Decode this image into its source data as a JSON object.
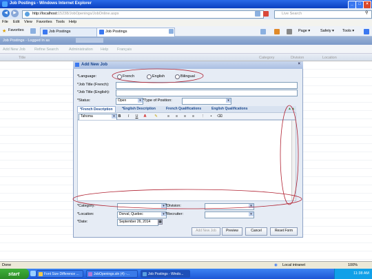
{
  "window": {
    "title": "Job Postings - Windows Internet Explorer"
  },
  "browser": {
    "address_host": "http://localhost:",
    "address_rest": "15238/JobOpenings/JobOnline.aspx",
    "search_placeholder": "Live Search",
    "menu": [
      "File",
      "Edit",
      "View",
      "Favorites",
      "Tools",
      "Help"
    ],
    "favorites_label": "Favorites",
    "tabs": [
      "Job Postings",
      "Job Postings"
    ],
    "commands": [
      "Page ▾",
      "Safety ▾",
      "Tools ▾"
    ]
  },
  "page": {
    "header": "Job Postings - Logged In as",
    "toolbar": [
      "Add New Job",
      "Refine Search",
      "Administration",
      "Help",
      "Français"
    ],
    "columns": [
      "Title",
      "Category",
      "Division",
      "Location"
    ]
  },
  "dialog": {
    "title": "Add New Job",
    "language_label": "*Language:",
    "language_options": [
      "French",
      "English",
      "Bilingual"
    ],
    "job_title_fr_label": "*Job Title (French):",
    "job_title_en_label": "*Job Title (English):",
    "status_label": "*Status:",
    "status_value": "Open",
    "position_type_label": "*Type of Position:",
    "editor_tabs": [
      "*French Description",
      "*English Description",
      "French Qualifications",
      "English Qualifications"
    ],
    "font_value": "Tahoma",
    "toolbar_glyphs": [
      "B",
      "I",
      "U",
      "A"
    ],
    "category_label": "*Category:",
    "division_label": "*Division:",
    "location_label": "*Location:",
    "location_value": "Dorval, Quebec",
    "recruiter_label": "*Recruiter:",
    "date_label": "*Date:",
    "date_value": "September 26, 2014",
    "buttons": [
      "Add New Job",
      "Preview",
      "Cancel",
      "Reset Form"
    ]
  },
  "statusbar": {
    "left": "Done",
    "zone": "Local intranet",
    "zoom": "100%"
  },
  "taskbar": {
    "start": "start",
    "tasks": [
      "Font Size Difference ...",
      "JobOpenings.sln (4) -...",
      "Job Postings - Windo..."
    ],
    "clock": "11:38 AM"
  },
  "annotations": {
    "ellipse_color": "#b02030"
  }
}
